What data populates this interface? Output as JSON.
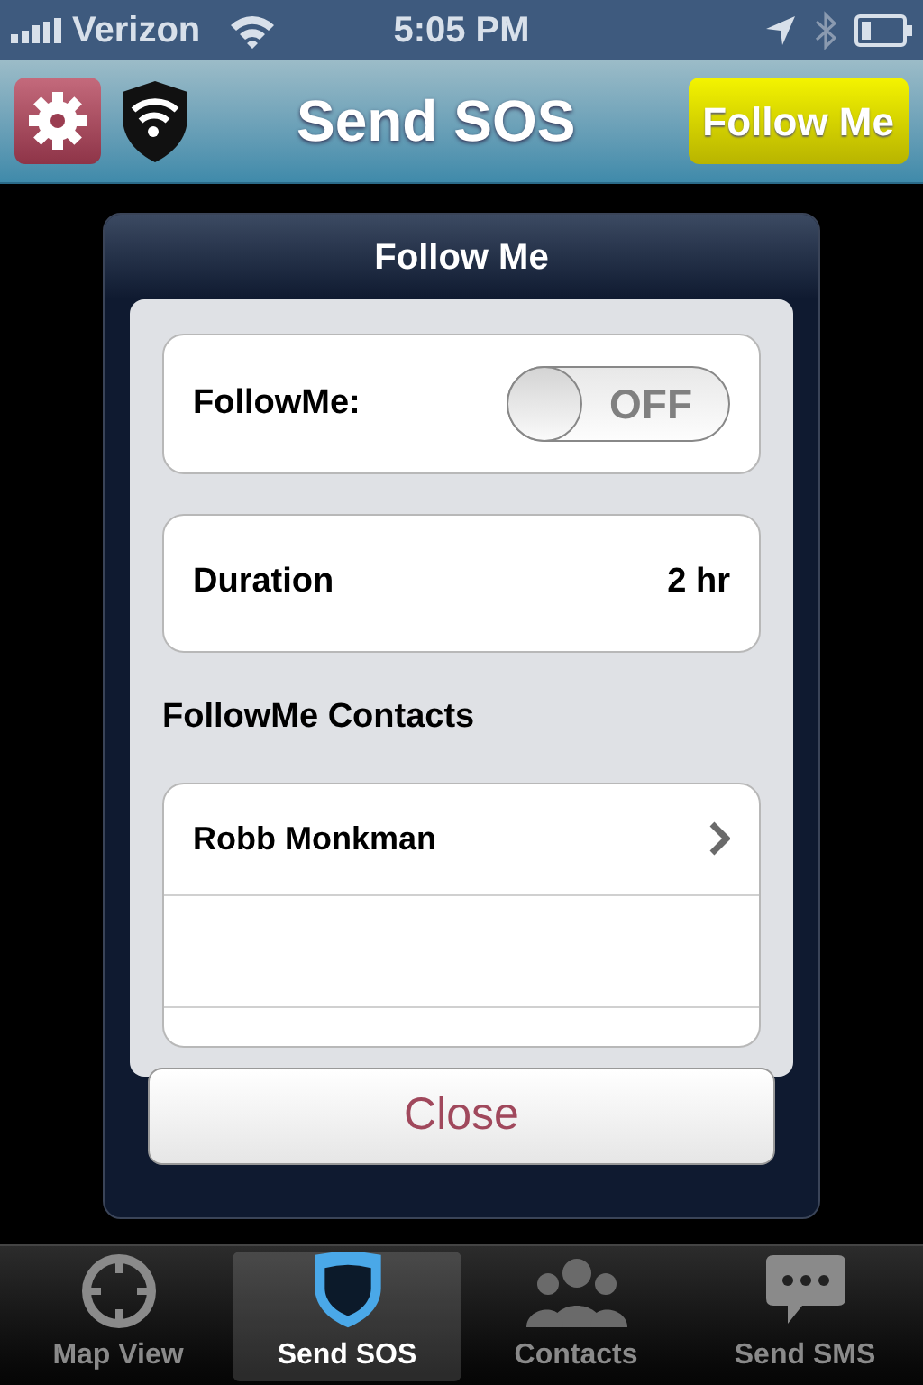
{
  "status_bar": {
    "carrier": "Verizon",
    "time": "5:05 PM"
  },
  "nav_bar": {
    "title": "Send SOS",
    "action_button": "Follow Me"
  },
  "dialog": {
    "title": "Follow Me",
    "followme_toggle": {
      "label": "FollowMe:",
      "on": false,
      "state_text": "OFF"
    },
    "duration": {
      "label": "Duration",
      "value": "2 hr"
    },
    "contacts_heading": "FollowMe Contacts",
    "contacts": [
      {
        "name": "Robb Monkman"
      }
    ],
    "close_button": "Close"
  },
  "tab_bar": [
    {
      "label": "Map View",
      "kind": "target",
      "selected": false
    },
    {
      "label": "Send SOS",
      "kind": "shield",
      "selected": true
    },
    {
      "label": "Contacts",
      "kind": "people",
      "selected": false
    },
    {
      "label": "Send SMS",
      "kind": "bubble",
      "selected": false
    }
  ]
}
